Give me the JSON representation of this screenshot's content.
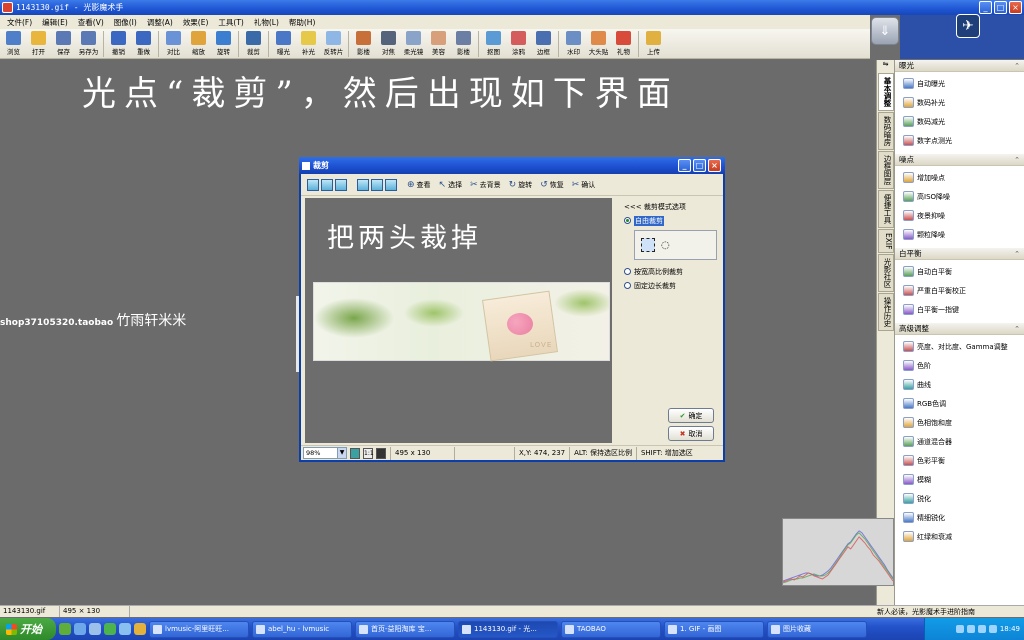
{
  "window": {
    "title": "1143130.gif - 光影魔术手",
    "min": "_",
    "max": "□",
    "close": "×"
  },
  "menu": [
    "文件(F)",
    "编辑(E)",
    "查看(V)",
    "图像(I)",
    "调整(A)",
    "效果(E)",
    "工具(T)",
    "礼物(L)",
    "帮助(H)"
  ],
  "toolbar": [
    {
      "label": "浏览",
      "icon": "browse-icon",
      "color": "#4f7fc9"
    },
    {
      "label": "打开",
      "icon": "open-folder-icon",
      "color": "#e8b63c"
    },
    {
      "label": "保存",
      "icon": "save-icon",
      "color": "#5a79b5"
    },
    {
      "label": "另存为",
      "icon": "save-as-icon",
      "color": "#5a79b5"
    },
    {
      "label": "撤销",
      "icon": "undo-icon",
      "color": "#3b68c0"
    },
    {
      "label": "重做",
      "icon": "redo-icon",
      "color": "#3b68c0"
    },
    {
      "label": "对比",
      "icon": "compare-icon",
      "color": "#6a92d6"
    },
    {
      "label": "缩放",
      "icon": "zoom-icon",
      "color": "#e0a43c"
    },
    {
      "label": "旋转",
      "icon": "rotate-icon",
      "color": "#3c7fd0"
    },
    {
      "label": "裁剪",
      "icon": "crop-icon",
      "color": "#3a6aa8"
    },
    {
      "label": "曝光",
      "icon": "exposure-icon",
      "color": "#4a78c6"
    },
    {
      "label": "补光",
      "icon": "fill-light-icon",
      "color": "#e7c94a"
    },
    {
      "label": "反转片",
      "icon": "reversal-film-icon",
      "color": "#8fb7e6"
    },
    {
      "label": "影楼",
      "icon": "studio-icon",
      "color": "#c8703a"
    },
    {
      "label": "对焦",
      "icon": "focus-icon",
      "color": "#55647a"
    },
    {
      "label": "柔光镜",
      "icon": "soft-light-icon",
      "color": "#89a3c9"
    },
    {
      "label": "美容",
      "icon": "beauty-icon",
      "color": "#d8a07a"
    },
    {
      "label": "影楼",
      "icon": "studio-portrait-icon",
      "color": "#6a7fa3"
    },
    {
      "label": "抠图",
      "icon": "cutout-icon",
      "color": "#5a9ad5"
    },
    {
      "label": "涂鸦",
      "icon": "doodle-icon",
      "color": "#d45c5c"
    },
    {
      "label": "边框",
      "icon": "frame-icon",
      "color": "#4a6fb0"
    },
    {
      "label": "水印",
      "icon": "watermark-icon",
      "color": "#6b8ec4"
    },
    {
      "label": "大头贴",
      "icon": "photo-sticker-icon",
      "color": "#e08a4a"
    },
    {
      "label": "礼物",
      "icon": "gift-icon",
      "color": "#d84a3a"
    },
    {
      "label": "上传",
      "icon": "upload-icon",
      "color": "#e0b040"
    }
  ],
  "download_glyph": "⇓",
  "logo_glyph": "✈",
  "instruction": "光点“裁剪”，然后出现如下界面",
  "shop": {
    "id": "shop37105320.taobao",
    "name": "竹雨轩米米"
  },
  "vtabs": [
    "基本调整",
    "数码暗房",
    "边框图层",
    "便捷工具",
    "EXIF",
    "光影社区",
    "操作历史"
  ],
  "panel_toggle": "⇋",
  "panel": [
    {
      "title": "曝光",
      "items": [
        "自动曝光",
        "数码补光",
        "数码减光",
        "数字点测光"
      ]
    },
    {
      "title": "噪点",
      "items": [
        "增加噪点",
        "高ISO降噪",
        "夜景抑噪",
        "颗粒降噪"
      ]
    },
    {
      "title": "白平衡",
      "items": [
        "自动白平衡",
        "严重白平衡校正",
        "白平衡一指键"
      ]
    },
    {
      "title": "高级调整",
      "items": [
        "亮度、对比度、Gamma调整",
        "色阶",
        "曲线",
        "RGB色调",
        "色相饱和度",
        "通道混合器",
        "色彩平衡",
        "模糊",
        "锐化",
        "精细锐化",
        "红绿和衰减"
      ]
    }
  ],
  "status": {
    "file": "1143130.gif",
    "size": "495 × 130"
  },
  "panel_status": "新人必读，光影魔术手进阶指南",
  "taskbar": {
    "start": "开始",
    "tasks": [
      "lvmusic-阿里旺旺...",
      "abel_hu - lvmusic",
      "首页-益阳淘库 宝...",
      "1143130.gif - 光...",
      "TAOBAO",
      "1. GIF - 画图",
      "图片收藏"
    ],
    "active_index": 3,
    "clock": "18:49"
  },
  "dialog": {
    "title": "裁剪",
    "buttons": [
      {
        "label": "查看",
        "glyph": "⊕"
      },
      {
        "label": "选择",
        "glyph": "↖"
      },
      {
        "label": "去背景",
        "glyph": "✂"
      },
      {
        "label": "旋转",
        "glyph": "↻"
      },
      {
        "label": "恢复",
        "glyph": "↺"
      },
      {
        "label": "确认",
        "glyph": "✂"
      }
    ],
    "handwriting": "把两头裁掉",
    "image_caption": "LOVE",
    "side_title": "<<< 裁剪模式选项",
    "options": [
      "自由裁剪",
      "按宽高比例裁剪",
      "固定边长裁剪"
    ],
    "checked": 0,
    "ok": "确定",
    "cancel": "取消",
    "zoom": "98%",
    "ratio": "1:1",
    "size": "495 x 130",
    "xy": "X,Y: 474, 237",
    "alt": "ALT: 保持选区比例",
    "shift": "SHIFT: 增加选区"
  },
  "histogram": {
    "red": [
      3,
      4,
      5,
      6,
      5,
      7,
      9,
      8,
      10,
      12,
      11,
      9,
      8,
      7,
      6,
      8,
      10,
      14,
      18,
      22,
      26,
      30,
      34,
      38,
      36,
      40,
      44,
      48,
      45,
      42,
      38,
      35,
      30,
      27,
      24,
      20,
      16,
      12,
      8,
      4
    ],
    "green": [
      2,
      3,
      4,
      5,
      6,
      6,
      7,
      7,
      8,
      9,
      10,
      11,
      10,
      9,
      9,
      10,
      12,
      15,
      19,
      23,
      27,
      32,
      36,
      40,
      42,
      46,
      50,
      52,
      49,
      46,
      42,
      38,
      34,
      30,
      26,
      22,
      18,
      14,
      10,
      6
    ],
    "blue": [
      4,
      5,
      6,
      7,
      8,
      9,
      10,
      11,
      12,
      12,
      11,
      10,
      9,
      9,
      10,
      12,
      14,
      17,
      21,
      25,
      29,
      33,
      37,
      41,
      43,
      47,
      51,
      54,
      52,
      48,
      44,
      40,
      36,
      32,
      28,
      24,
      20,
      15,
      11,
      7
    ]
  }
}
